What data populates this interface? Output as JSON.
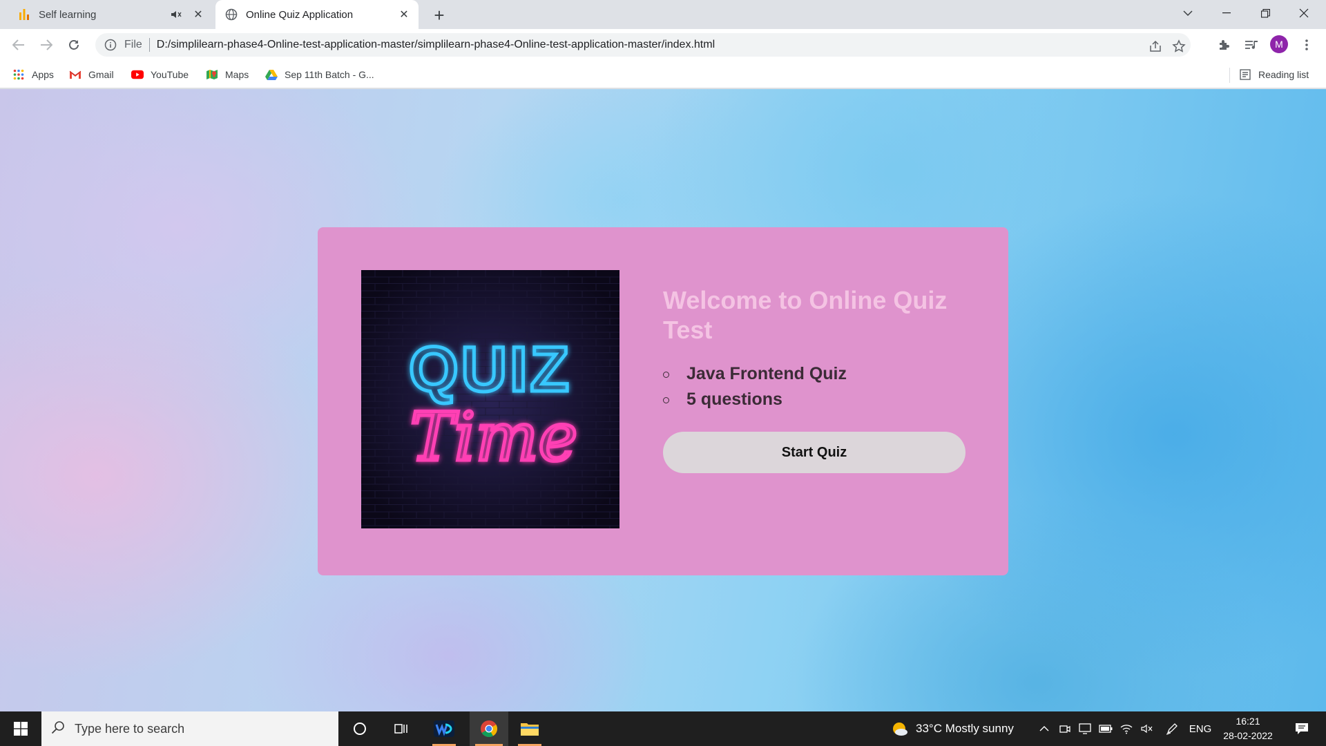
{
  "browser": {
    "tabs": [
      {
        "title": "Self learning",
        "active": false
      },
      {
        "title": "Online Quiz Application",
        "active": true
      }
    ],
    "address": {
      "scheme_label": "File",
      "url": "D:/simplilearn-phase4-Online-test-application-master/simplilearn-phase4-Online-test-application-master/index.html"
    },
    "profile_initial": "M",
    "bookmarks": [
      {
        "label": "Apps",
        "icon": "apps-grid-icon"
      },
      {
        "label": "Gmail",
        "icon": "gmail-icon"
      },
      {
        "label": "YouTube",
        "icon": "youtube-icon"
      },
      {
        "label": "Maps",
        "icon": "maps-icon"
      },
      {
        "label": "Sep 11th Batch - G...",
        "icon": "drive-icon"
      }
    ],
    "reading_list": "Reading list"
  },
  "page": {
    "image_text": {
      "line1": "QUIZ",
      "line2": "Time"
    },
    "welcome_title": "Welcome to Online Quiz Test",
    "info": [
      "Java Frontend Quiz",
      "5 questions"
    ],
    "start_button": "Start Quiz",
    "colors": {
      "card": "#df93cd",
      "title": "#f4c3e3",
      "button": "#dcd6da"
    }
  },
  "taskbar": {
    "search_placeholder": "Type here to search",
    "weather": "33°C  Mostly sunny",
    "language": "ENG",
    "time": "16:21",
    "date": "28-02-2022"
  }
}
